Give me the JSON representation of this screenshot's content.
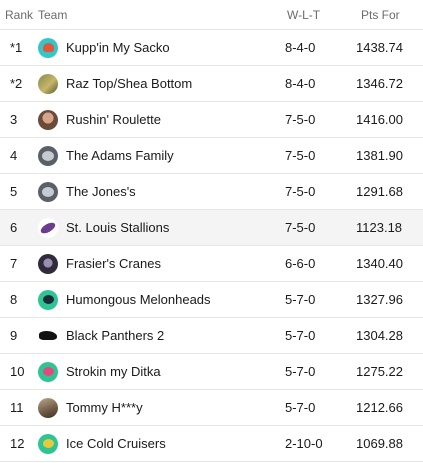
{
  "header": {
    "rank": "Rank",
    "team": "Team",
    "wlt": "W-L-T",
    "pts_for": "Pts For"
  },
  "rows": [
    {
      "rank": "*1",
      "team": "Kupp'in My Sacko",
      "wlt": "8-4-0",
      "pts": "1438.74",
      "avatar": "teal-helmet-icon"
    },
    {
      "rank": "*2",
      "team": "Raz Top/Shea Bottom",
      "wlt": "8-4-0",
      "pts": "1346.72",
      "avatar": "team-photo-icon"
    },
    {
      "rank": "3",
      "team": "Rushin' Roulette",
      "wlt": "7-5-0",
      "pts": "1416.00",
      "avatar": "team-photo-icon"
    },
    {
      "rank": "4",
      "team": "The Adams Family",
      "wlt": "7-5-0",
      "pts": "1381.90",
      "avatar": "grey-helmet-icon"
    },
    {
      "rank": "5",
      "team": "The Jones's",
      "wlt": "7-5-0",
      "pts": "1291.68",
      "avatar": "grey-helmet-icon"
    },
    {
      "rank": "6",
      "team": "St. Louis Stallions",
      "wlt": "7-5-0",
      "pts": "1123.18",
      "avatar": "eggplant-icon",
      "highlight": true
    },
    {
      "rank": "7",
      "team": "Frasier's Cranes",
      "wlt": "6-6-0",
      "pts": "1340.40",
      "avatar": "team-photo-icon"
    },
    {
      "rank": "8",
      "team": "Humongous Melonheads",
      "wlt": "5-7-0",
      "pts": "1327.96",
      "avatar": "green-helmet-icon"
    },
    {
      "rank": "9",
      "team": "Black Panthers 2",
      "wlt": "5-7-0",
      "pts": "1304.28",
      "avatar": "panther-icon"
    },
    {
      "rank": "10",
      "team": "Strokin my Ditka",
      "wlt": "5-7-0",
      "pts": "1275.22",
      "avatar": "pink-helmet-icon"
    },
    {
      "rank": "11",
      "team": "Tommy H***y",
      "wlt": "5-7-0",
      "pts": "1212.66",
      "avatar": "team-photo-icon"
    },
    {
      "rank": "12",
      "team": "Ice Cold Cruisers",
      "wlt": "2-10-0",
      "pts": "1069.88",
      "avatar": "yellow-helmet-icon"
    }
  ],
  "colors": {
    "highlight_row": "#f4f4f4",
    "divider": "#e6e6e6",
    "header_text": "#6b6b6b"
  }
}
